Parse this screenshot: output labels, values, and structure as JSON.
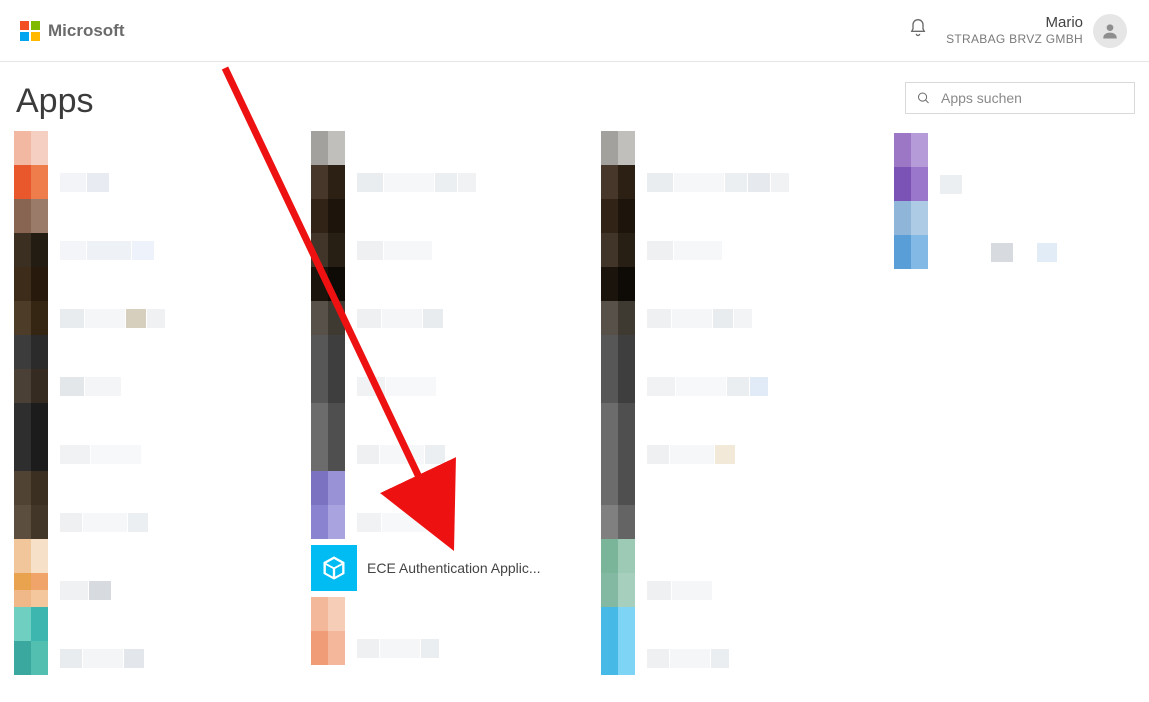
{
  "header": {
    "brand": "Microsoft",
    "user_name": "Mario",
    "user_org": "STRABAG BRVZ GMBH"
  },
  "page": {
    "title": "Apps"
  },
  "search": {
    "placeholder": "Apps suchen"
  },
  "apps": {
    "visible_tile_label": "ECE Authentication Applic..."
  }
}
